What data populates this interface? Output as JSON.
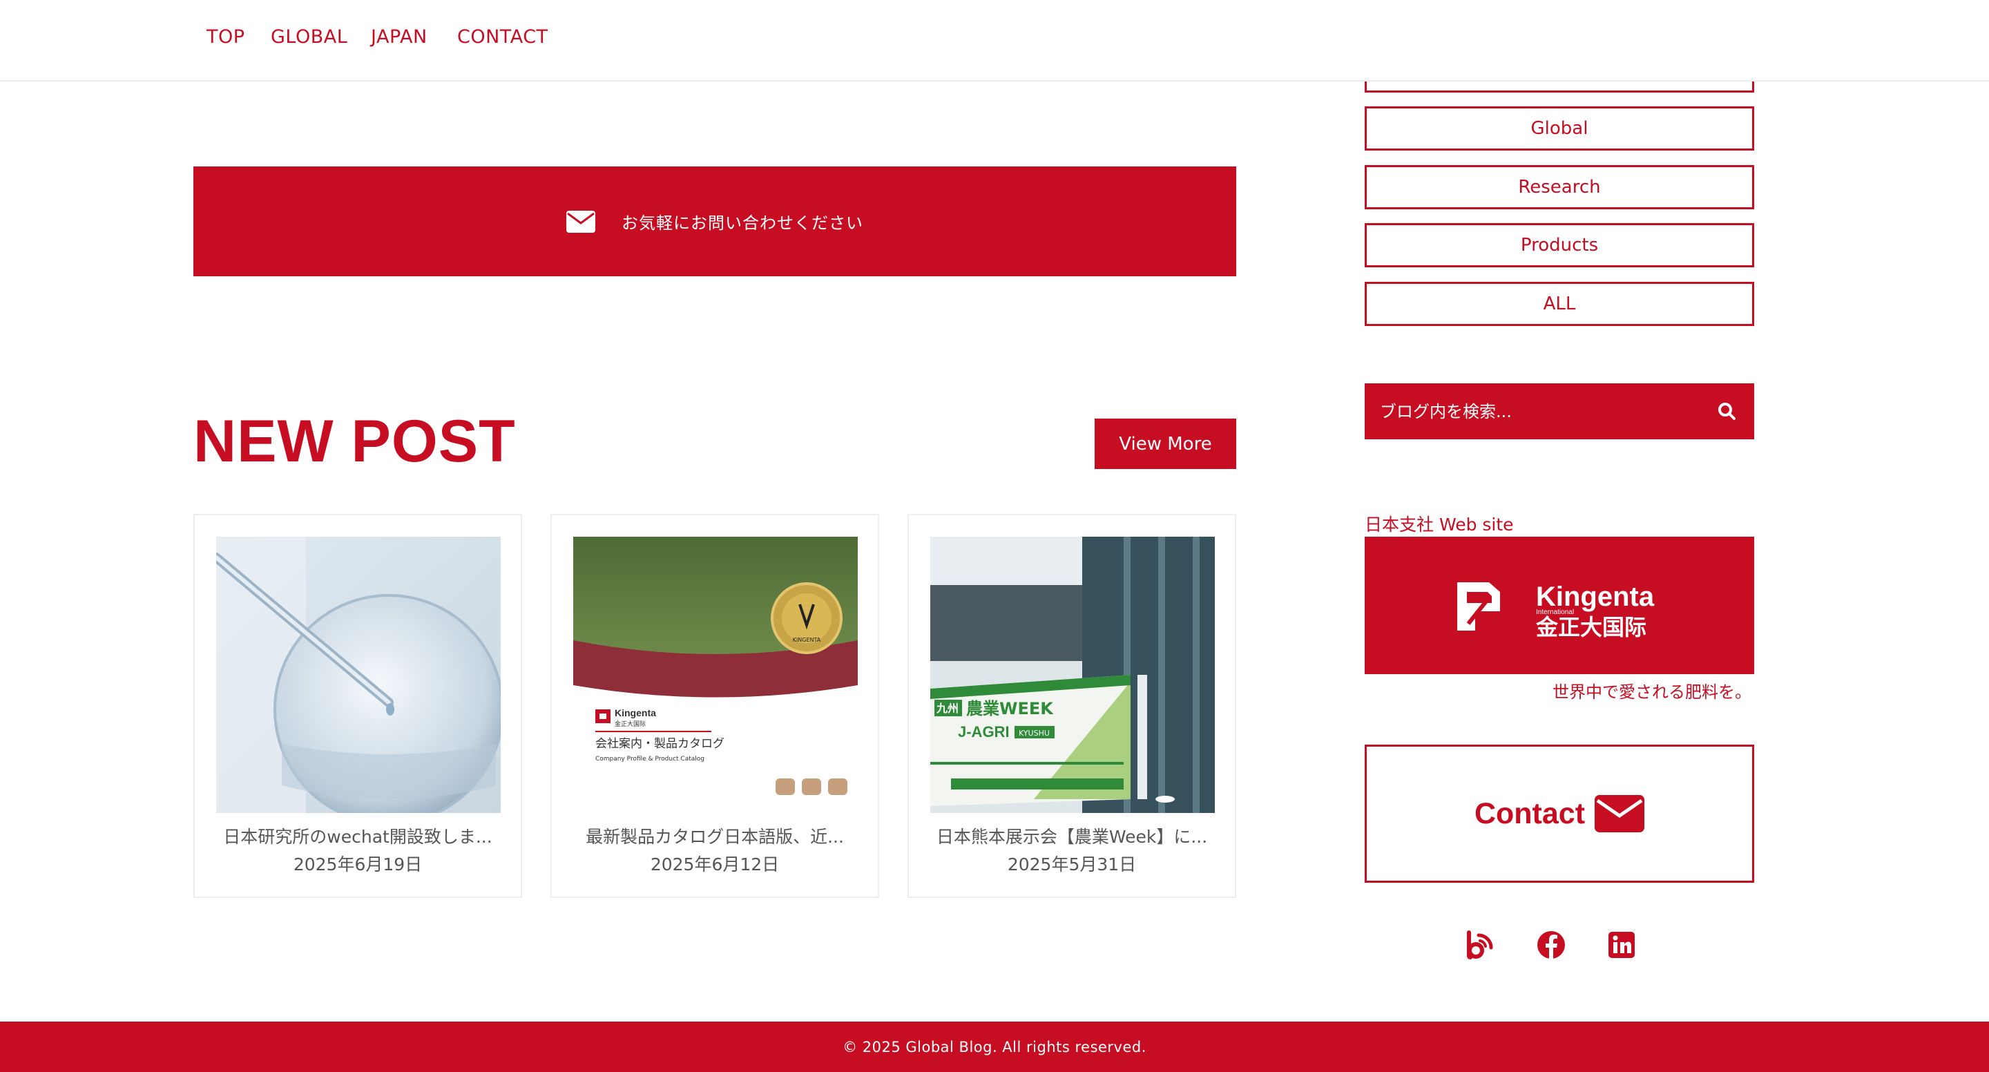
{
  "nav": {
    "items": [
      "TOP",
      "GLOBAL",
      "JAPAN",
      "CONTACT"
    ]
  },
  "sidebar": {
    "categories": [
      "Global",
      "Research",
      "Products",
      "ALL"
    ],
    "search": {
      "placeholder": "ブログ内を検索..."
    },
    "japan_label": "日本支社 Web site",
    "brand": {
      "name": "Kingenta",
      "subname": "International",
      "chinese": "金正大国际"
    },
    "tagline": "世界中で愛される肥料を。",
    "contact_label": "Contact",
    "social": [
      "blog-icon",
      "facebook-icon",
      "linkedin-icon"
    ]
  },
  "contact_banner": {
    "text": "お気軽にお問い合わせください"
  },
  "new_post": {
    "title": "NEW POST",
    "view_more": "View More",
    "posts": [
      {
        "title": "日本研究所のwechat開設致しま...",
        "date": "2025年6月19日"
      },
      {
        "title": "最新製品カタログ日本語版、近...",
        "date": "2025年6月12日",
        "thumb": {
          "brand": "Kingenta",
          "brand_cn": "金正大国际",
          "heading": "会社案内・製品カタログ",
          "sub": "Company Profile & Product Catalog",
          "badge": "KINGENTA"
        }
      },
      {
        "title": "日本熊本展示会【農業Week】に...",
        "date": "2025年5月31日",
        "thumb": {
          "logo_jp": "九州",
          "heading": "農業WEEK",
          "sub1": "J-AGRI",
          "sub2": "KYUSHU"
        }
      }
    ]
  },
  "footer": {
    "copyright": "© 2025 Global Blog. All rights reserved."
  },
  "colors": {
    "accent": "#c70d22",
    "text_gray": "#555555"
  }
}
